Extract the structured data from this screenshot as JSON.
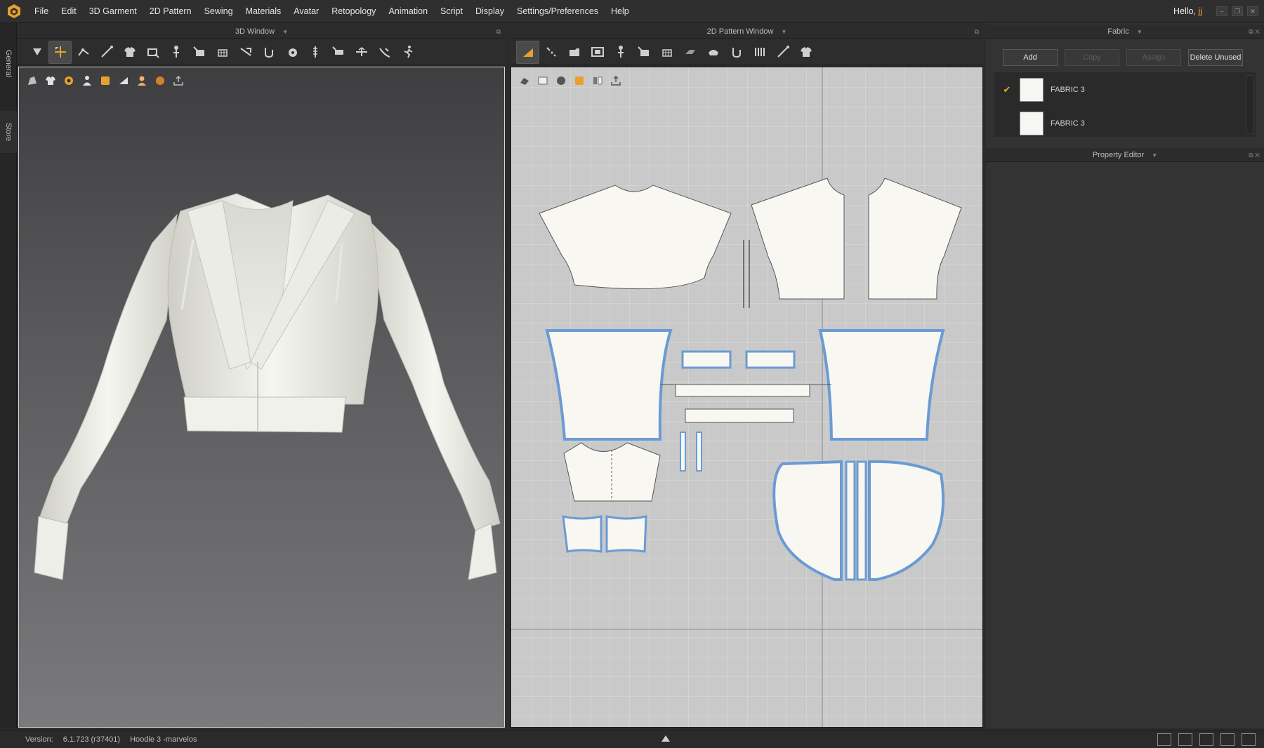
{
  "menubar": {
    "items": [
      "File",
      "Edit",
      "3D Garment",
      "2D Pattern",
      "Sewing",
      "Materials",
      "Avatar",
      "Retopology",
      "Animation",
      "Script",
      "Display",
      "Settings/Preferences",
      "Help"
    ],
    "greeting": "Hello,",
    "user": "jj"
  },
  "side_tabs": {
    "general": "General",
    "store": "Store"
  },
  "panels": {
    "window_3d": "3D Window",
    "window_2d": "2D Pattern Window",
    "fabric": "Fabric",
    "property_editor": "Property Editor"
  },
  "fabric": {
    "buttons": {
      "add": "Add",
      "copy": "Copy",
      "assign": "Assign",
      "delete_unused": "Delete Unused"
    },
    "items": [
      {
        "name": "FABRIC 3",
        "checked": true
      },
      {
        "name": "FABRIC 3",
        "checked": false
      }
    ]
  },
  "status": {
    "version_label": "Version:",
    "version": "6.1.723 (r37401)",
    "file": "Hoodie 3 -marvelos"
  },
  "colors": {
    "accent": "#e7a53a",
    "pattern_fill": "#f8f7f1",
    "pattern_outline": "#6a9bd4",
    "grid_bg": "#c9c9c9"
  },
  "icons": {
    "toolbar_3d": [
      "select-move-icon",
      "transform-icon",
      "edit-pattern-icon",
      "edit-curve-icon",
      "garment-fit-icon",
      "rotate-icon",
      "pin-icon",
      "segment-sewing-icon",
      "free-sewing-icon",
      "tack-icon",
      "fold-icon",
      "button-icon",
      "zipper-icon",
      "measure-icon",
      "pressure-icon",
      "strengthen-icon",
      "shirring-icon",
      "avatar-pose-icon"
    ],
    "toolbar_2d": [
      "transform-pattern-icon",
      "edit-pattern-icon",
      "rectangle-icon",
      "internal-rectangle-icon",
      "sewing-icon",
      "segment-sewing-icon",
      "free-sewing-icon",
      "fold-icon",
      "button-icon",
      "zipper-icon",
      "pleat-icon",
      "measure-icon",
      "garment-icon"
    ]
  }
}
